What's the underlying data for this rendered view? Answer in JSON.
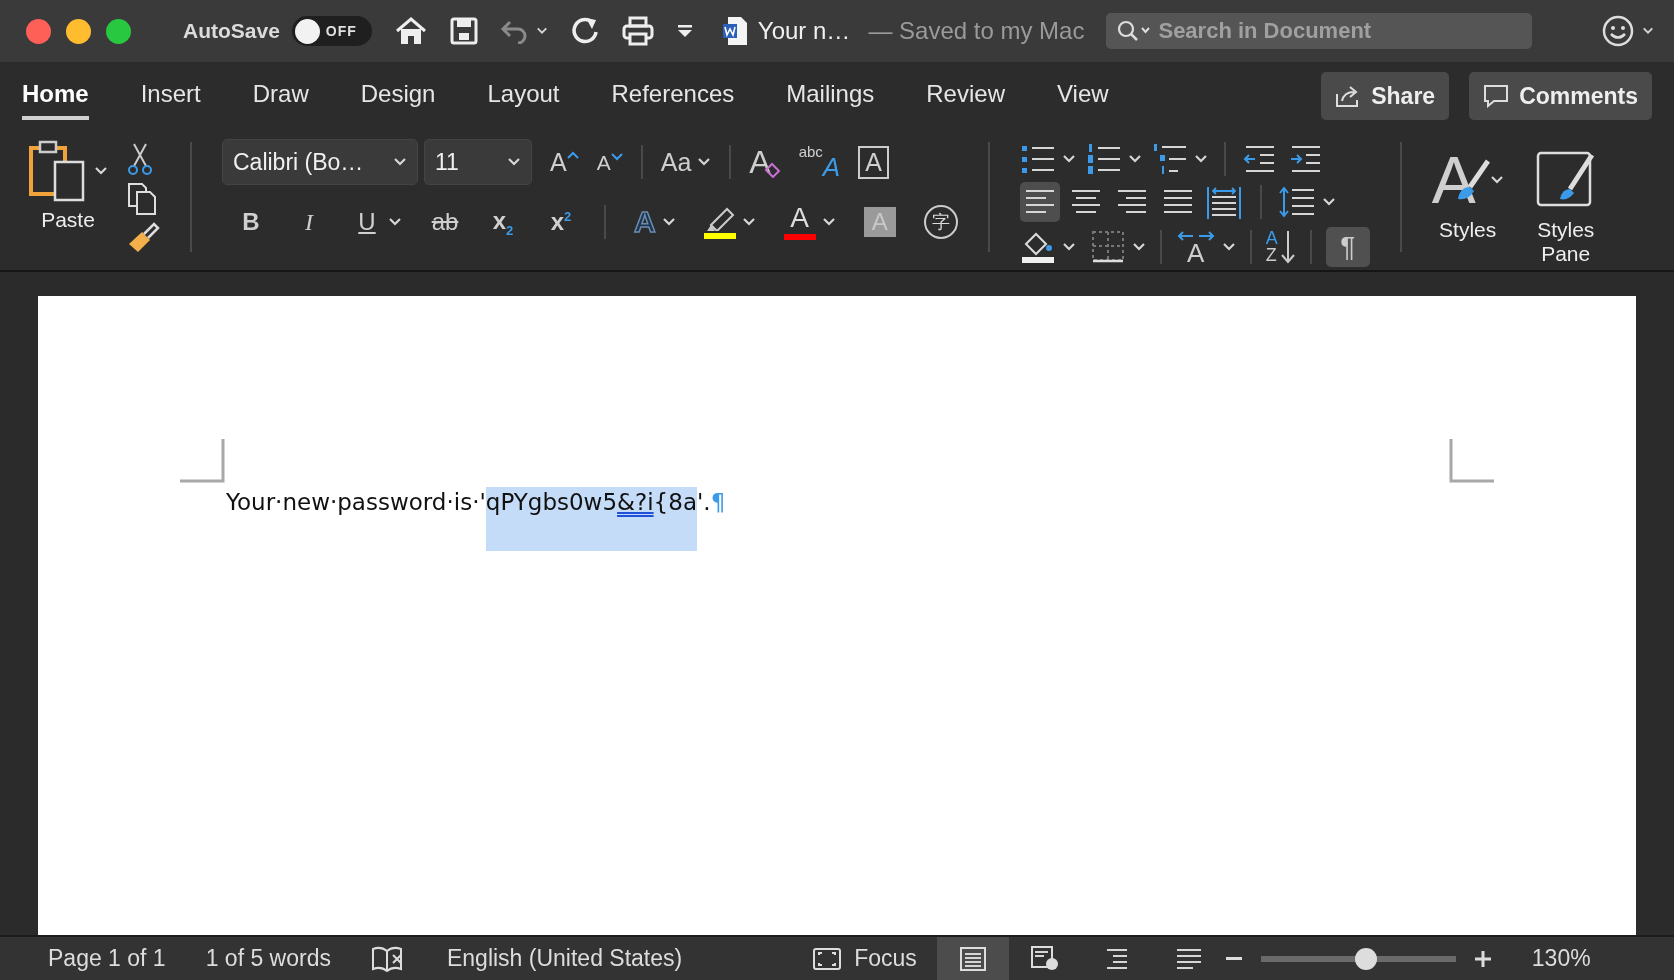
{
  "window": {
    "autosave": {
      "label": "AutoSave",
      "state": "OFF",
      "on": false
    },
    "title": "Your n…",
    "subtitle": "— Saved to my Mac",
    "search": {
      "placeholder": "Search in Document"
    }
  },
  "tabs": [
    {
      "label": "Home",
      "selected": true
    },
    {
      "label": "Insert",
      "selected": false
    },
    {
      "label": "Draw",
      "selected": false
    },
    {
      "label": "Design",
      "selected": false
    },
    {
      "label": "Layout",
      "selected": false
    },
    {
      "label": "References",
      "selected": false
    },
    {
      "label": "Mailings",
      "selected": false
    },
    {
      "label": "Review",
      "selected": false
    },
    {
      "label": "View",
      "selected": false
    }
  ],
  "actions": {
    "share": "Share",
    "comments": "Comments"
  },
  "ribbon": {
    "clipboard": {
      "paste": "Paste"
    },
    "font": {
      "name": "Calibri (Bo…",
      "size": "11",
      "grow": "A",
      "shrink": "A",
      "change_case": "Aa",
      "clear": "A",
      "phonetic": "abc",
      "phonetic_letter": "A",
      "border": "A"
    },
    "format_buttons": [
      {
        "kind": "bold",
        "label": "B"
      },
      {
        "kind": "italic",
        "label": "I"
      },
      {
        "kind": "underline",
        "label": "U"
      },
      {
        "kind": "strikethrough",
        "label": "ab"
      },
      {
        "kind": "subscript",
        "label": "x",
        "index": "2"
      },
      {
        "kind": "superscript",
        "label": "x",
        "index": "2"
      }
    ],
    "effects": [
      {
        "kind": "text-effects",
        "label": "A"
      },
      {
        "kind": "highlight",
        "color": "#ffff00"
      },
      {
        "kind": "font-color",
        "label": "A",
        "color": "#ff0000"
      },
      {
        "kind": "shading",
        "label": "A"
      },
      {
        "kind": "enclose",
        "label": "字"
      }
    ],
    "alignment": [
      {
        "kind": "left",
        "selected": true
      },
      {
        "kind": "center",
        "selected": false
      },
      {
        "kind": "right",
        "selected": false
      },
      {
        "kind": "justify",
        "selected": false
      },
      {
        "kind": "distributed",
        "selected": false
      }
    ],
    "text_direction": "A",
    "sort": {
      "top": "A",
      "bottom": "Z"
    },
    "show_marks": {
      "label": "¶",
      "on": true
    },
    "styles": {
      "gallery": {
        "label": "Styles",
        "letter": "A"
      },
      "pane": {
        "label": "Styles Pane"
      }
    }
  },
  "document": {
    "segments": [
      {
        "text": "Your·new·password·is·'",
        "selected": false,
        "underlined": false
      },
      {
        "text": "qPYgbs0w5",
        "selected": true,
        "underlined": false
      },
      {
        "text": "&?i",
        "selected": true,
        "underlined": true
      },
      {
        "text": "{8a",
        "selected": true,
        "underlined": false
      },
      {
        "text": "'.",
        "selected": false,
        "underlined": false
      }
    ],
    "pilcrow": "¶"
  },
  "status_bar": {
    "page": "Page 1 of 1",
    "words": "1 of 5 words",
    "language": "English (United States)",
    "focus": "Focus",
    "views": [
      {
        "kind": "print",
        "selected": true
      },
      {
        "kind": "web",
        "selected": false
      },
      {
        "kind": "outline",
        "selected": false
      },
      {
        "kind": "draft",
        "selected": false
      }
    ],
    "zoom": {
      "level": 0.54,
      "reading": "130%"
    }
  }
}
